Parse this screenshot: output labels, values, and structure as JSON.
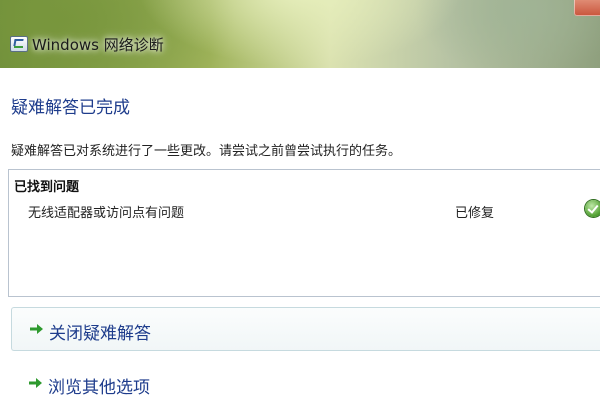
{
  "window": {
    "title": "Windows 网络诊断"
  },
  "main": {
    "heading": "疑难解答已完成",
    "description": "疑难解答已对系统进行了一些更改。请尝试之前曾尝试执行的任务。",
    "problems": {
      "header": "已找到问题",
      "items": [
        {
          "name": "无线适配器或访问点有问题",
          "status": "已修复",
          "status_icon": "check-circle-icon"
        }
      ]
    },
    "options": [
      {
        "label": "关闭疑难解答",
        "icon": "green-arrow-icon"
      },
      {
        "label": "浏览其他选项",
        "icon": "green-arrow-icon"
      }
    ]
  },
  "colors": {
    "heading_blue": "#1e3c8c",
    "arrow_green": "#2e9a2e",
    "success_green": "#4e9e2e"
  }
}
